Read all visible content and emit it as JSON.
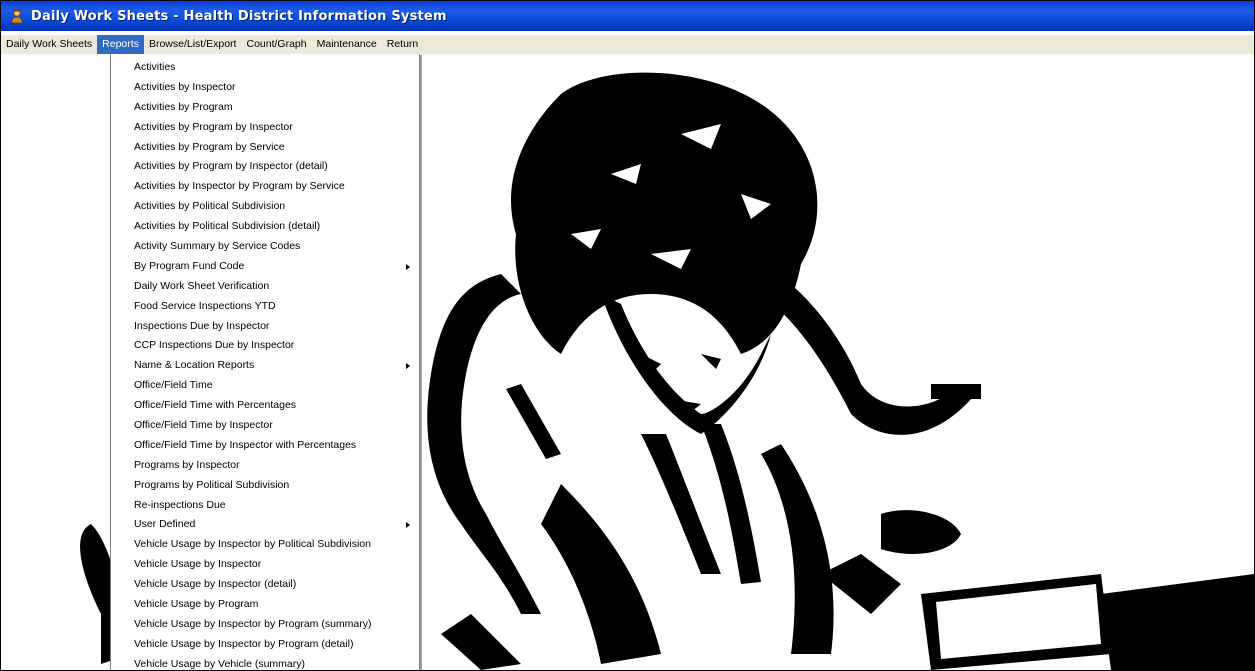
{
  "window": {
    "title": "Daily Work Sheets - Health District Information System",
    "icon": "app-person-icon"
  },
  "menubar": {
    "items": [
      {
        "label": "Daily Work Sheets"
      },
      {
        "label": "Reports",
        "active": true
      },
      {
        "label": "Browse/List/Export"
      },
      {
        "label": "Count/Graph"
      },
      {
        "label": "Maintenance"
      },
      {
        "label": "Return"
      }
    ]
  },
  "reports_menu": {
    "items": [
      {
        "label": "Activities"
      },
      {
        "label": "Activities by Inspector"
      },
      {
        "label": "Activities by Program"
      },
      {
        "label": "Activities by Program by Inspector"
      },
      {
        "label": "Activities by Program by Service"
      },
      {
        "label": "Activities by Program by Inspector (detail)"
      },
      {
        "label": "Activities by Inspector by Program by Service"
      },
      {
        "label": "Activities by Political Subdivision"
      },
      {
        "label": "Activities by Political Subdivision (detail)"
      },
      {
        "label": "Activity Summary by Service Codes"
      },
      {
        "label": "By Program Fund Code",
        "submenu": true
      },
      {
        "label": "Daily Work Sheet Verification"
      },
      {
        "label": "Food Service Inspections YTD"
      },
      {
        "label": "Inspections Due by Inspector"
      },
      {
        "label": "CCP Inspections Due  by Inspector"
      },
      {
        "label": "Name & Location Reports",
        "submenu": true
      },
      {
        "label": "Office/Field Time"
      },
      {
        "label": "Office/Field Time with Percentages"
      },
      {
        "label": "Office/Field Time by Inspector"
      },
      {
        "label": "Office/Field Time by Inspector with Percentages"
      },
      {
        "label": "Programs by Inspector"
      },
      {
        "label": "Programs by Political Subdivision"
      },
      {
        "label": "Re-inspections Due"
      },
      {
        "label": "User Defined",
        "submenu": true
      },
      {
        "label": "Vehicle Usage by Inspector by Political Subdivision"
      },
      {
        "label": "Vehicle Usage by Inspector"
      },
      {
        "label": "Vehicle Usage by Inspector (detail)"
      },
      {
        "label": "Vehicle Usage by Program"
      },
      {
        "label": "Vehicle Usage by Inspector by Program (summary)"
      },
      {
        "label": "Vehicle Usage by Inspector by Program (detail)"
      },
      {
        "label": "Vehicle Usage by Vehicle (summary)"
      }
    ]
  },
  "background": {
    "image": "stressed-man-clipart"
  },
  "colors": {
    "titlebar": "#0a3ed8",
    "menu_highlight": "#316ac5",
    "menubar_bg": "#ece9d8"
  }
}
